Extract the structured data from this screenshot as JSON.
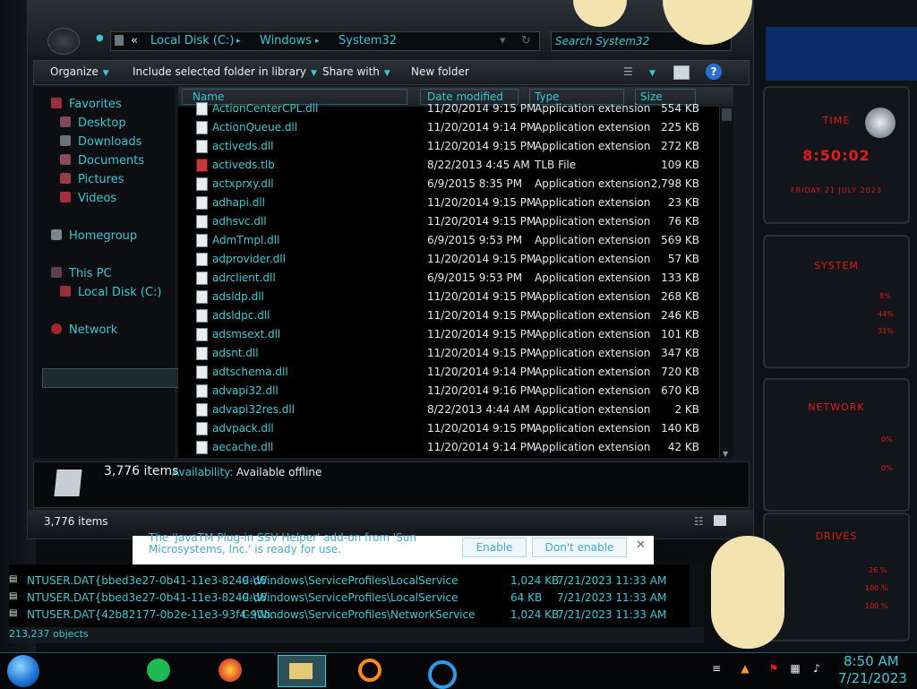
{
  "explorer": {
    "breadcrumb": {
      "prefix": "«",
      "items": [
        "Local Disk (C:)",
        "Windows",
        "System32"
      ]
    },
    "search_placeholder": "Search System32",
    "toolbar": {
      "organize": "Organize",
      "include": "Include selected folder in library",
      "share": "Share with",
      "new_folder": "New folder"
    },
    "nav": {
      "favorites": "Favorites",
      "desktop": "Desktop",
      "downloads": "Downloads",
      "documents": "Documents",
      "pictures": "Pictures",
      "videos": "Videos",
      "homegroup": "Homegroup",
      "this_pc": "This PC",
      "local_disk": "Local Disk (C:)",
      "network": "Network"
    },
    "columns": {
      "name": "Name",
      "date": "Date modified",
      "type": "Type",
      "size": "Size"
    },
    "files": [
      {
        "name": "ActionCenterCPL.dll",
        "date": "11/20/2014 9:15 PM",
        "type": "Application extension",
        "size": "554 KB",
        "icon": "dll"
      },
      {
        "name": "ActionQueue.dll",
        "date": "11/20/2014 9:14 PM",
        "type": "Application extension",
        "size": "225 KB",
        "icon": "dll"
      },
      {
        "name": "activeds.dll",
        "date": "11/20/2014 9:15 PM",
        "type": "Application extension",
        "size": "272 KB",
        "icon": "dll"
      },
      {
        "name": "activeds.tlb",
        "date": "8/22/2013 4:45 AM",
        "type": "TLB File",
        "size": "109 KB",
        "icon": "tlb"
      },
      {
        "name": "actxprxy.dll",
        "date": "6/9/2015 8:35 PM",
        "type": "Application extension",
        "size": "2,798 KB",
        "icon": "dll"
      },
      {
        "name": "adhapi.dll",
        "date": "11/20/2014 9:15 PM",
        "type": "Application extension",
        "size": "23 KB",
        "icon": "dll"
      },
      {
        "name": "adhsvc.dll",
        "date": "11/20/2014 9:15 PM",
        "type": "Application extension",
        "size": "76 KB",
        "icon": "dll"
      },
      {
        "name": "AdmTmpl.dll",
        "date": "6/9/2015 9:53 PM",
        "type": "Application extension",
        "size": "569 KB",
        "icon": "dll"
      },
      {
        "name": "adprovider.dll",
        "date": "11/20/2014 9:15 PM",
        "type": "Application extension",
        "size": "57 KB",
        "icon": "dll"
      },
      {
        "name": "adrclient.dll",
        "date": "6/9/2015 9:53 PM",
        "type": "Application extension",
        "size": "133 KB",
        "icon": "dll"
      },
      {
        "name": "adsldp.dll",
        "date": "11/20/2014 9:15 PM",
        "type": "Application extension",
        "size": "268 KB",
        "icon": "dll"
      },
      {
        "name": "adsldpc.dll",
        "date": "11/20/2014 9:15 PM",
        "type": "Application extension",
        "size": "246 KB",
        "icon": "dll"
      },
      {
        "name": "adsmsext.dll",
        "date": "11/20/2014 9:15 PM",
        "type": "Application extension",
        "size": "101 KB",
        "icon": "dll"
      },
      {
        "name": "adsnt.dll",
        "date": "11/20/2014 9:15 PM",
        "type": "Application extension",
        "size": "347 KB",
        "icon": "dll"
      },
      {
        "name": "adtschema.dll",
        "date": "11/20/2014 9:14 PM",
        "type": "Application extension",
        "size": "720 KB",
        "icon": "dll"
      },
      {
        "name": "advapi32.dll",
        "date": "11/20/2014 9:16 PM",
        "type": "Application extension",
        "size": "670 KB",
        "icon": "dll"
      },
      {
        "name": "advapi32res.dll",
        "date": "8/22/2013 4:44 AM",
        "type": "Application extension",
        "size": "2 KB",
        "icon": "dll"
      },
      {
        "name": "advpack.dll",
        "date": "11/20/2014 9:15 PM",
        "type": "Application extension",
        "size": "140 KB",
        "icon": "dll"
      },
      {
        "name": "aecache.dll",
        "date": "11/20/2014 9:14 PM",
        "type": "Application extension",
        "size": "42 KB",
        "icon": "dll"
      }
    ],
    "details": {
      "count": "3,776 items",
      "availability_label": "Availability:",
      "availability_value": "Available offline"
    },
    "status_count": "3,776 items"
  },
  "notification": {
    "text": "The 'JavaTM Plug-in SSV Helper' add-on from 'Sun Microsystems, Inc.' is ready for use.",
    "enable": "Enable",
    "dont_enable": "Don't enable",
    "close": "✕"
  },
  "second_window": {
    "rows": [
      {
        "name": "NTUSER.DAT{bbed3e27-0b41-11e3-8249-d6...",
        "path": "C:\\Windows\\ServiceProfiles\\LocalService",
        "size": "1,024 KB",
        "date": "7/21/2023 11:33 AM"
      },
      {
        "name": "NTUSER.DAT{bbed3e27-0b41-11e3-8249-d6...",
        "path": "C:\\Windows\\ServiceProfiles\\LocalService",
        "size": "64 KB",
        "date": "7/21/2023 11:33 AM"
      },
      {
        "name": "NTUSER.DAT{42b82177-0b2e-11e3-93f4-90b...",
        "path": "C:\\Windows\\ServiceProfiles\\NetworkService",
        "size": "1,024 KB",
        "date": "7/21/2023 11:33 AM"
      }
    ],
    "status": "213,237 objects"
  },
  "gadgets": {
    "time_title": "TIME",
    "time_value": "8:50:02",
    "date_value": "FRIDAY 21 JULY 2023",
    "system_title": "SYSTEM",
    "system_vals": [
      "8%",
      "44%",
      "31%"
    ],
    "network_title": "NETWORK",
    "network_vals": [
      "0%",
      "0%"
    ],
    "drives_title": "DRIVES",
    "drives_vals": [
      "26 %",
      "100 %",
      "100 %"
    ]
  },
  "taskbar": {
    "time": "8:50 AM",
    "date": "7/21/2023"
  },
  "colors": {
    "accent": "#39c7d4",
    "gadget_red": "#e31b1b"
  }
}
